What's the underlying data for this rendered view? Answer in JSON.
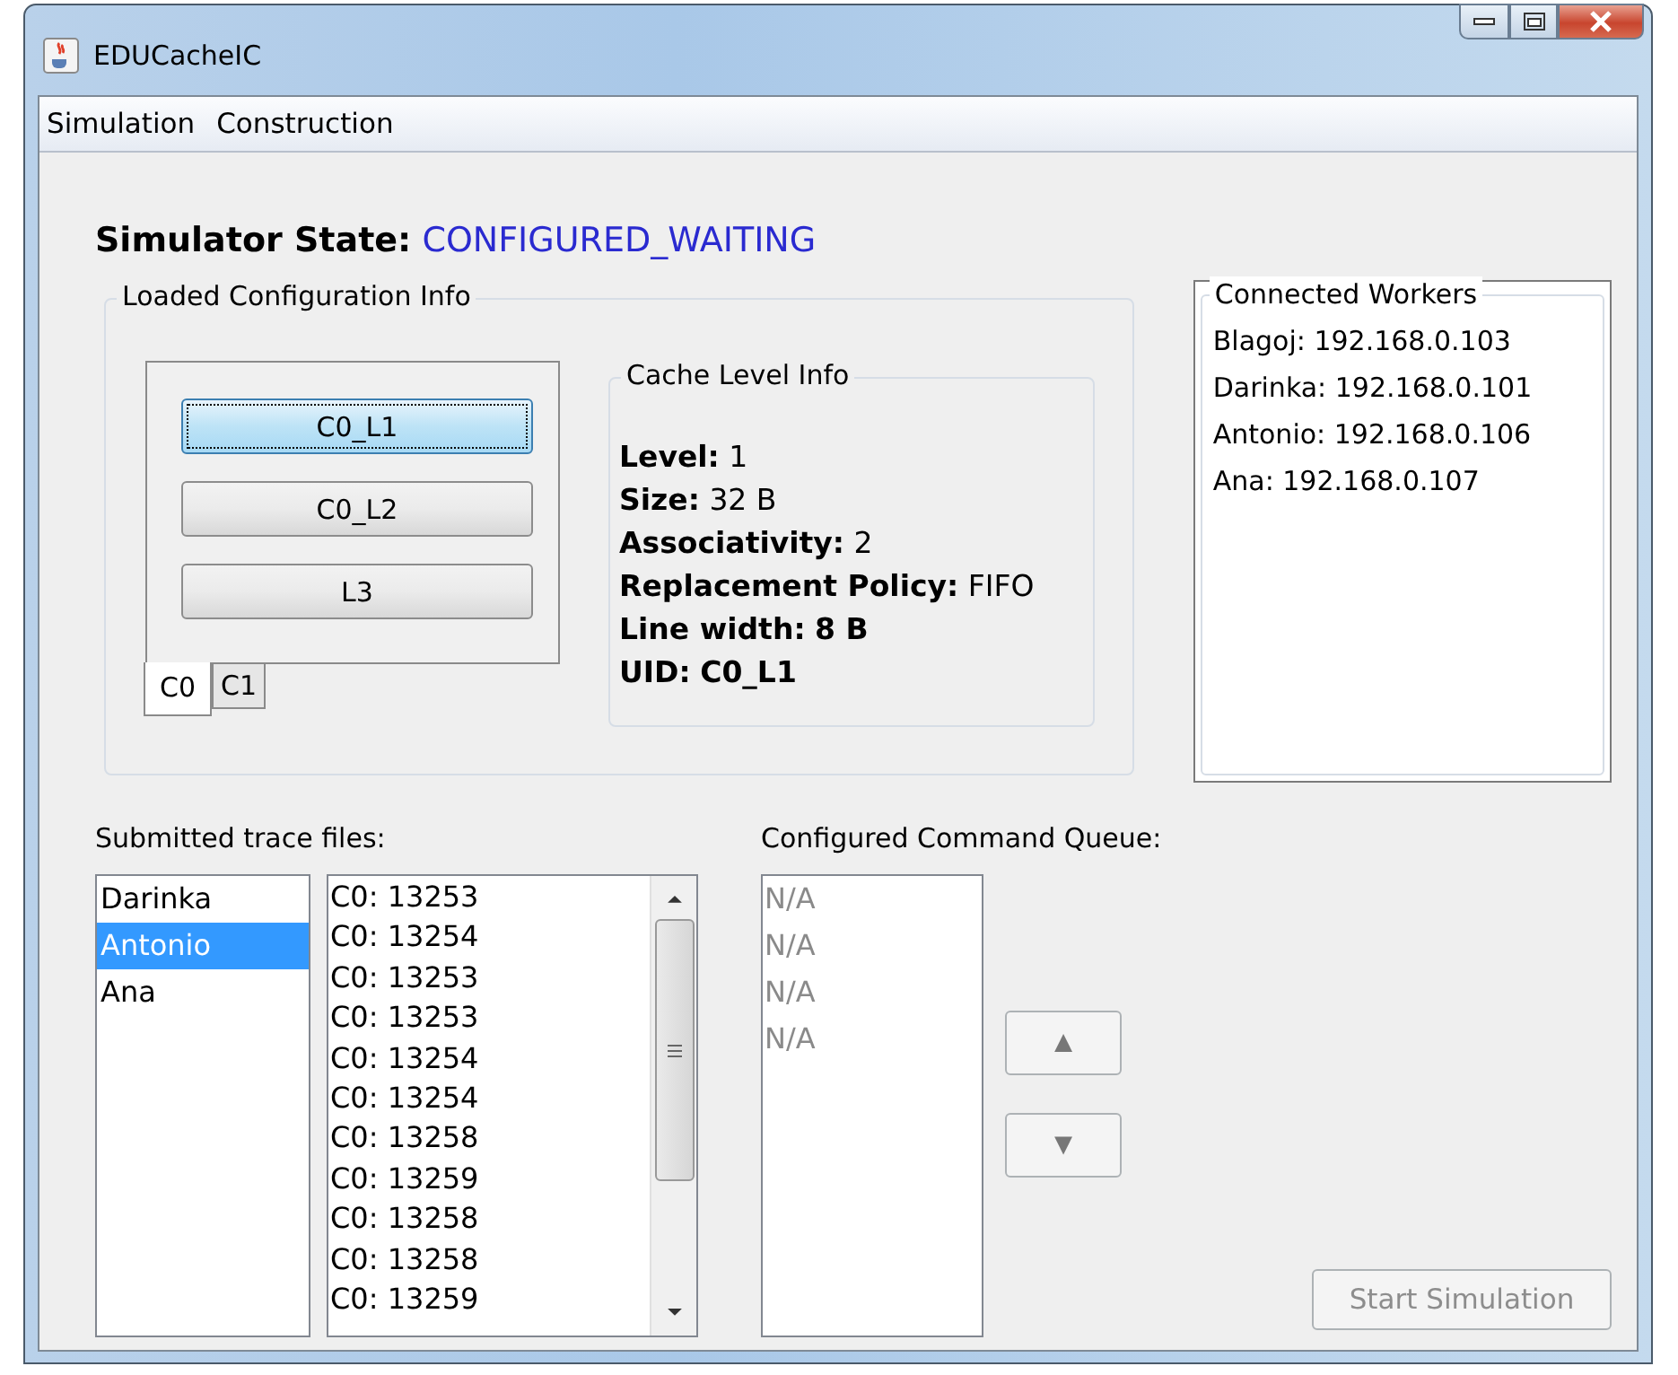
{
  "window": {
    "title": "EDUCacheIC"
  },
  "menu": [
    "Simulation",
    "Construction"
  ],
  "simulator_state": {
    "label": "Simulator State:",
    "value": "CONFIGURED_WAITING"
  },
  "loaded_config": {
    "title": "Loaded Configuration Info",
    "level_buttons": [
      {
        "label": "C0_L1",
        "selected": true
      },
      {
        "label": "C0_L2",
        "selected": false
      },
      {
        "label": "L3",
        "selected": false
      }
    ],
    "tabs": [
      {
        "label": "C0",
        "selected": true
      },
      {
        "label": "C1",
        "selected": false
      }
    ],
    "cache_level_info": {
      "title": "Cache Level Info",
      "fields": [
        {
          "label": "Level:",
          "value": "1",
          "value_bold": false
        },
        {
          "label": "Size:",
          "value": "32 B",
          "value_bold": false
        },
        {
          "label": "Associativity:",
          "value": "2",
          "value_bold": false
        },
        {
          "label": "Replacement Policy:",
          "value": "FIFO",
          "value_bold": false
        },
        {
          "label": "Line width:",
          "value": "8 B",
          "value_bold": true
        },
        {
          "label": "UID:",
          "value": "C0_L1",
          "value_bold": true
        }
      ]
    }
  },
  "connected_workers": {
    "title": "Connected Workers",
    "workers": [
      "Blagoj: 192.168.0.103",
      "Darinka: 192.168.0.101",
      "Antonio: 192.168.0.106",
      "Ana: 192.168.0.107"
    ]
  },
  "trace_files": {
    "label": "Submitted trace files:",
    "users": [
      {
        "name": "Darinka",
        "selected": false
      },
      {
        "name": "Antonio",
        "selected": true
      },
      {
        "name": "Ana",
        "selected": false
      }
    ],
    "traces": [
      "C0: 13253",
      "C0: 13254",
      "C0: 13253",
      "C0: 13253",
      "C0: 13254",
      "C0: 13254",
      "C0: 13258",
      "C0: 13259",
      "C0: 13258",
      "C0: 13258",
      "C0: 13259"
    ]
  },
  "command_queue": {
    "label": "Configured Command Queue:",
    "items": [
      "N/A",
      "N/A",
      "N/A",
      "N/A"
    ]
  },
  "move_buttons": [
    "▲",
    "▼"
  ],
  "start_button": {
    "label": "Start Simulation",
    "disabled": true
  }
}
